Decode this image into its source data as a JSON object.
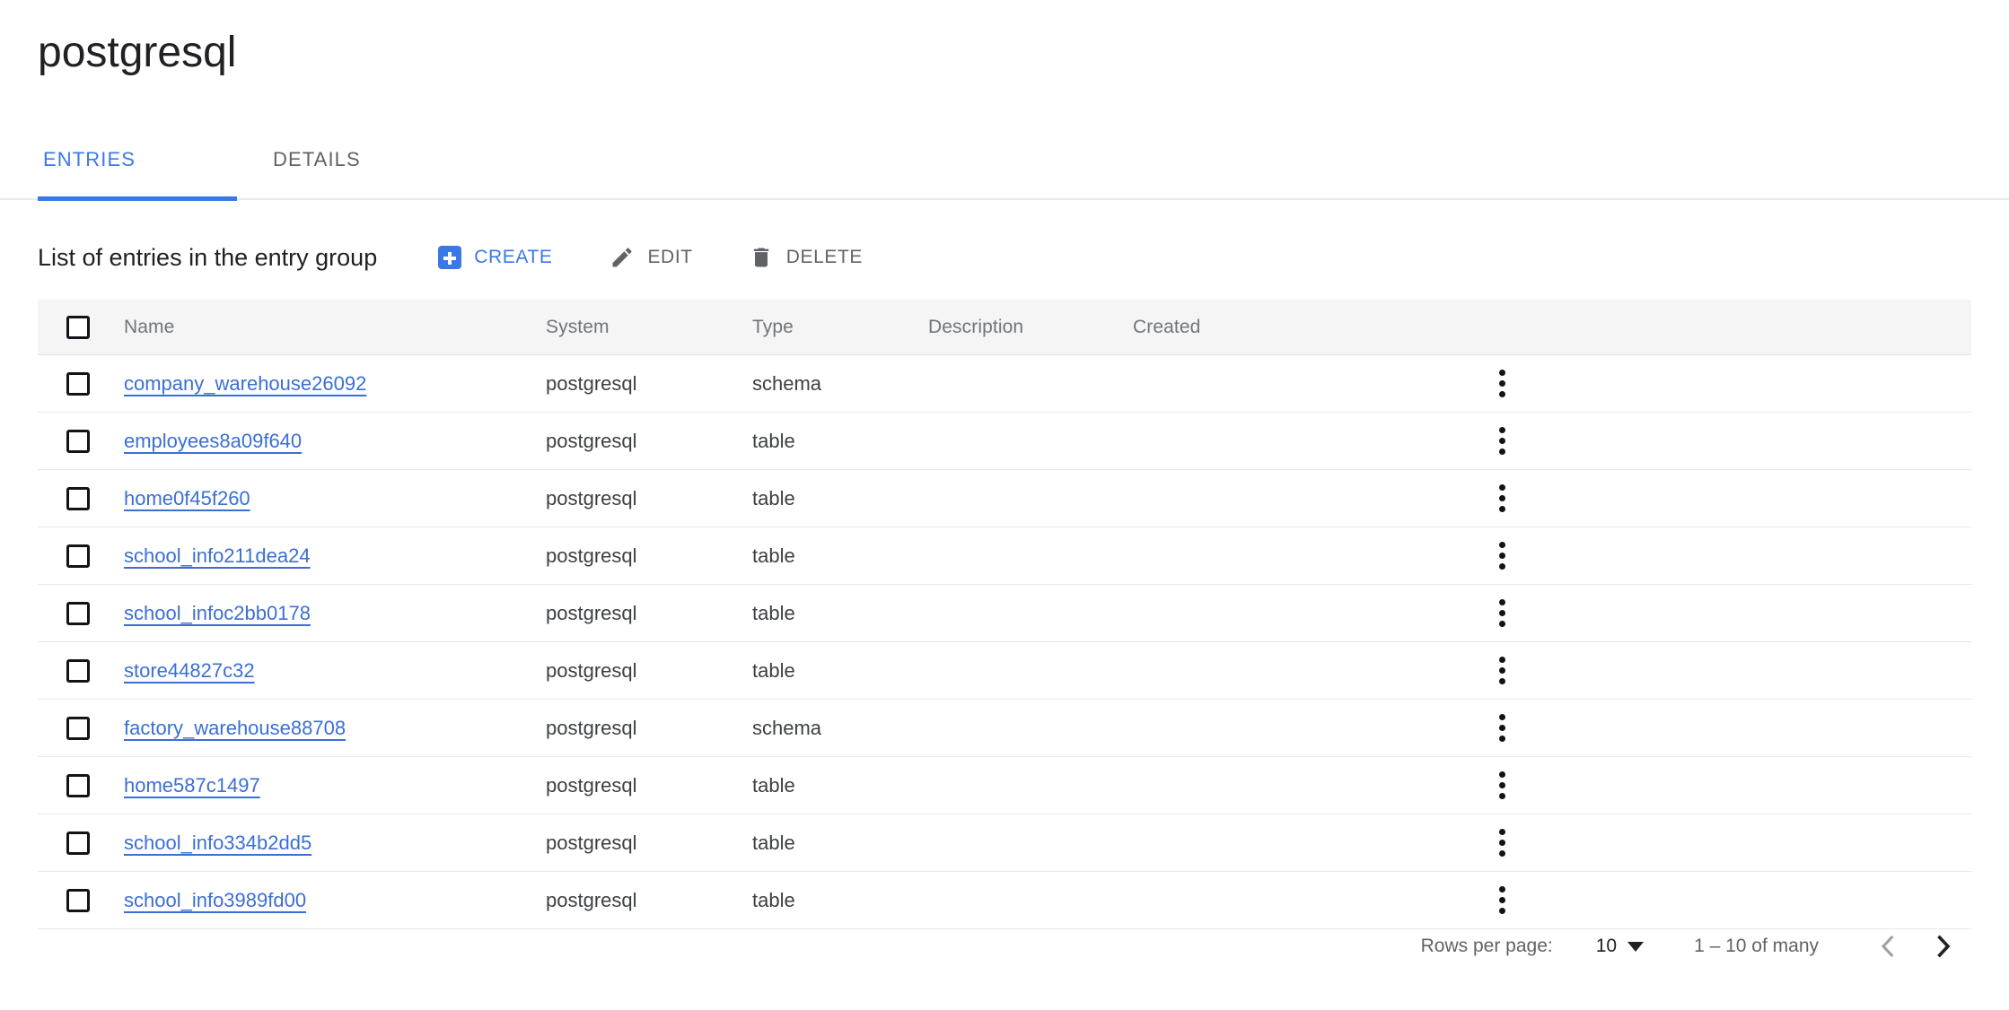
{
  "header": {
    "title": "postgresql"
  },
  "tabs": [
    {
      "label": "ENTRIES",
      "active": true
    },
    {
      "label": "DETAILS",
      "active": false
    }
  ],
  "toolbar": {
    "title": "List of entries in the entry group",
    "create_label": "CREATE",
    "edit_label": "EDIT",
    "delete_label": "DELETE",
    "create_icon": "add-box-icon",
    "edit_icon": "pencil-icon",
    "delete_icon": "trash-icon"
  },
  "table": {
    "columns": [
      "Name",
      "System",
      "Type",
      "Description",
      "Created"
    ],
    "rows": [
      {
        "name": "company_warehouse26092",
        "system": "postgresql",
        "type": "schema",
        "description": "",
        "created": ""
      },
      {
        "name": "employees8a09f640",
        "system": "postgresql",
        "type": "table",
        "description": "",
        "created": ""
      },
      {
        "name": "home0f45f260",
        "system": "postgresql",
        "type": "table",
        "description": "",
        "created": ""
      },
      {
        "name": "school_info211dea24",
        "system": "postgresql",
        "type": "table",
        "description": "",
        "created": ""
      },
      {
        "name": "school_infoc2bb0178",
        "system": "postgresql",
        "type": "table",
        "description": "",
        "created": ""
      },
      {
        "name": "store44827c32",
        "system": "postgresql",
        "type": "table",
        "description": "",
        "created": ""
      },
      {
        "name": "factory_warehouse88708",
        "system": "postgresql",
        "type": "schema",
        "description": "",
        "created": ""
      },
      {
        "name": "home587c1497",
        "system": "postgresql",
        "type": "table",
        "description": "",
        "created": ""
      },
      {
        "name": "school_info334b2dd5",
        "system": "postgresql",
        "type": "table",
        "description": "",
        "created": ""
      },
      {
        "name": "school_info3989fd00",
        "system": "postgresql",
        "type": "table",
        "description": "",
        "created": ""
      }
    ]
  },
  "paginator": {
    "rows_per_page_label": "Rows per page:",
    "rows_per_page_value": "10",
    "range_label": "1 – 10 of many",
    "prev_icon": "chevron-left-icon",
    "next_icon": "chevron-right-icon"
  },
  "colors": {
    "accent_blue": "#3b78e7",
    "link_blue": "#3b6fd4",
    "muted_text": "#5f6368",
    "header_bg": "#f5f5f5",
    "body_text": "#202124"
  }
}
